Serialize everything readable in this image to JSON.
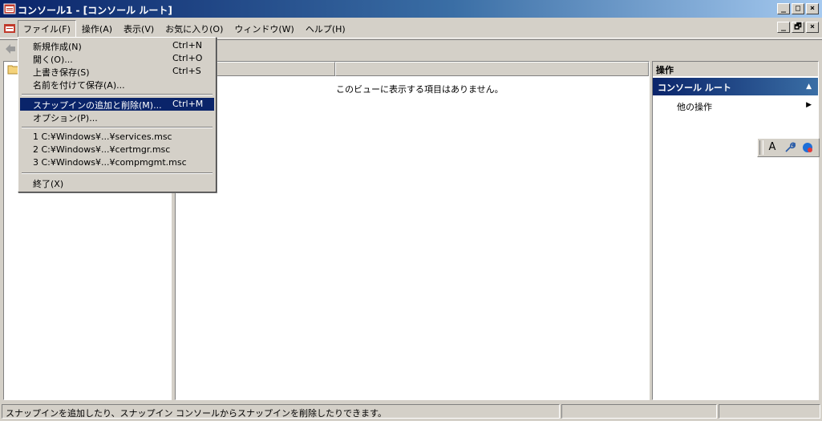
{
  "window": {
    "title": "コンソール1 - [コンソール ルート]",
    "outer_buttons": [
      "_",
      "□",
      "×"
    ],
    "inner_buttons": [
      "_",
      "🗗",
      "×"
    ]
  },
  "menubar": {
    "items": [
      {
        "label": "ファイル(F)"
      },
      {
        "label": "操作(A)"
      },
      {
        "label": "表示(V)"
      },
      {
        "label": "お気に入り(O)"
      },
      {
        "label": "ウィンドウ(W)"
      },
      {
        "label": "ヘルプ(H)"
      }
    ]
  },
  "file_menu": {
    "items": [
      {
        "label": "新規作成(N)",
        "shortcut": "Ctrl+N"
      },
      {
        "label": "開く(O)...",
        "shortcut": "Ctrl+O"
      },
      {
        "label": "上書き保存(S)",
        "shortcut": "Ctrl+S"
      },
      {
        "label": "名前を付けて保存(A)...",
        "shortcut": ""
      },
      {
        "label": "スナップインの追加と削除(M)...",
        "shortcut": "Ctrl+M"
      },
      {
        "label": "オプション(P)...",
        "shortcut": ""
      },
      {
        "label": "1 C:¥Windows¥...¥services.msc",
        "shortcut": ""
      },
      {
        "label": "2 C:¥Windows¥...¥certmgr.msc",
        "shortcut": ""
      },
      {
        "label": "3 C:¥Windows¥...¥compmgmt.msc",
        "shortcut": ""
      },
      {
        "label": "終了(X)",
        "shortcut": ""
      }
    ]
  },
  "center": {
    "empty_message": "このビューに表示する項目はありません。"
  },
  "actions": {
    "header": "操作",
    "group_title": "コンソール ルート",
    "row_label": "他の操作"
  },
  "ime": {
    "mode_label": "A"
  },
  "status": {
    "message": "スナップインを追加したり、スナップイン コンソールからスナップインを削除したりできます。"
  },
  "colors": {
    "titlebar_start": "#0a246a",
    "titlebar_end": "#a6caf0",
    "highlight": "#0a246a",
    "face": "#d4d0c8"
  }
}
